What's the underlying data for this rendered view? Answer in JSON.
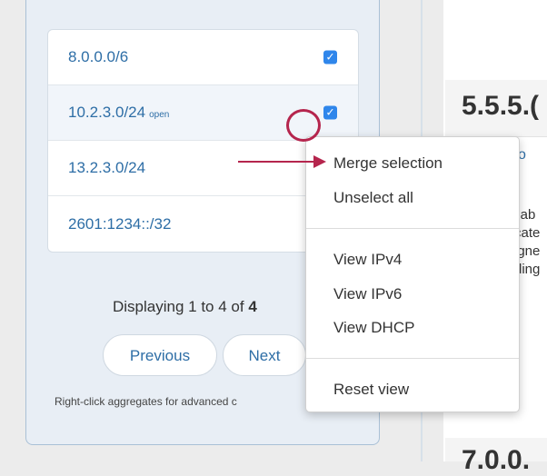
{
  "networks": {
    "rows": [
      {
        "label": "8.0.0.0/6",
        "tag": "",
        "checked": true
      },
      {
        "label": "10.2.3.0/24",
        "tag": "open",
        "checked": true
      },
      {
        "label": "13.2.3.0/24",
        "tag": "",
        "checked": false
      },
      {
        "label": "2601:1234::/32",
        "tag": "",
        "checked": false
      }
    ],
    "check_glyph": "✓"
  },
  "pagination": {
    "display_prefix": "Displaying 1 to 4 of",
    "display_total": "4",
    "previous_label": "Previous",
    "next_label": "Next"
  },
  "hint": "Right-click aggregates for advanced c",
  "content": {
    "title": "5.5.5.(",
    "link": "o",
    "lines": [
      "ilab",
      "cate",
      "igne",
      "ding"
    ],
    "bottom_title": "7.0.0."
  },
  "context_menu": {
    "merge_selection": "Merge selection",
    "unselect_all": "Unselect all",
    "view_ipv4": "View IPv4",
    "view_ipv6": "View IPv6",
    "view_dhcp": "View DHCP",
    "reset_view": "Reset view"
  },
  "colors": {
    "link": "#2e6ea6",
    "checkbox": "#2f86eb",
    "annotation": "#b5254d"
  }
}
